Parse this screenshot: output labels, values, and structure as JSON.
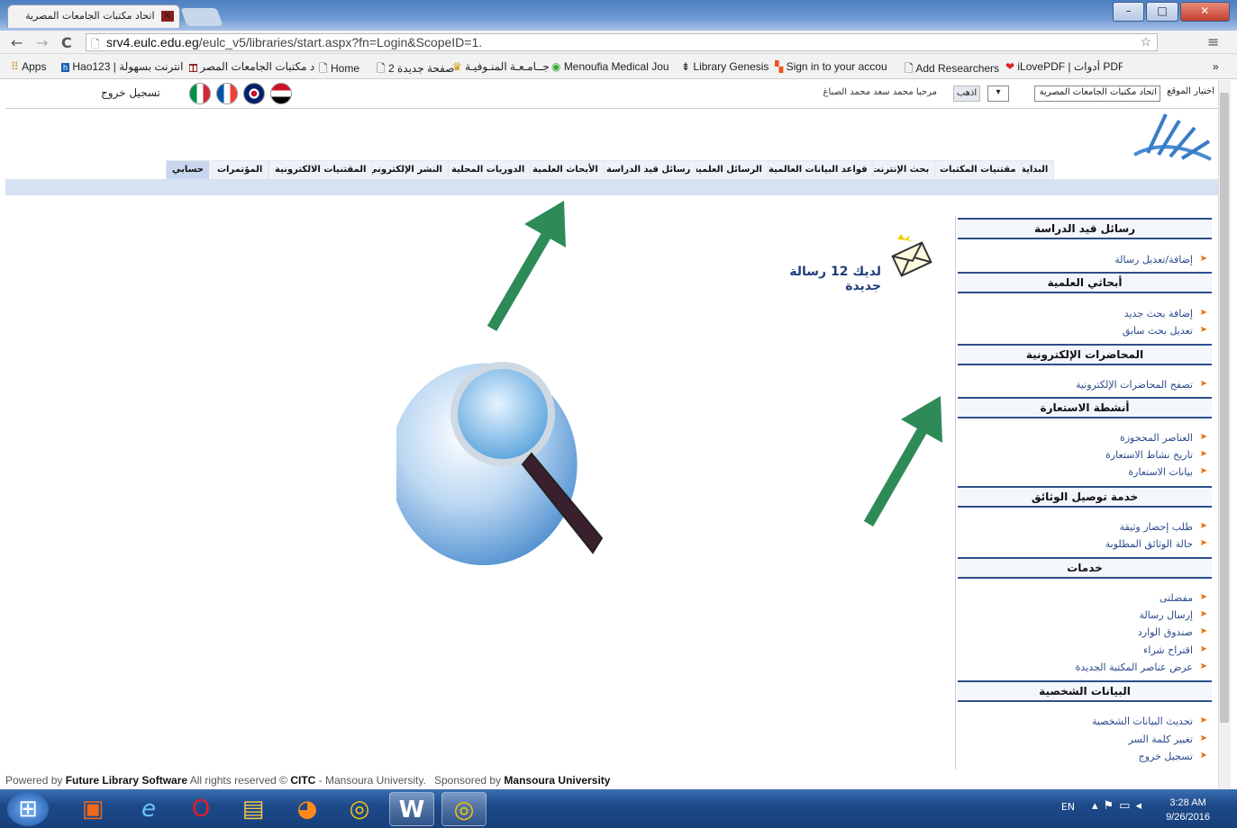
{
  "browser": {
    "tab_title": "اتحاد مكتبات الجامعات المصرية",
    "url_host": "srv4.eulc.edu.eg",
    "url_path": "/eulc_v5/libraries/start.aspx?fn=Login&ScopeID=1."
  },
  "bookmarks": [
    "Apps",
    "Hao123 | انترنت بسهولة",
    "اتحاد مكتبات الجامعات المصر",
    "Home",
    "صفحة جديدة 2",
    "جــامـعـة المنـوفيـة",
    "Menoufia Medical Jou",
    "Library Genesis",
    "Sign in to your accou",
    "Add Researchers",
    "iLovePDF | أدوات PDF"
  ],
  "topline": {
    "site_label": "اختيار الموقع",
    "site_value": "اتحاد مكتبات الجامعات المصرية",
    "go_label": "اذهب",
    "welcome": "مرحبا  محمد سعد محمد الصباغ",
    "logout": "تسجيل خروج"
  },
  "menu": [
    "البداية",
    "مقتنيات المكتبات",
    "بحث الإنترنت",
    "قواعد البيانات العالمية",
    "الرسائل العلمية",
    "رسائل قيد الدراسة",
    "الأبحاث العلمية",
    "الدوريات المحلية",
    "النشر الإلكتروني",
    "المقتنيات الالكترونية",
    "المؤتمرات",
    "حسابي"
  ],
  "notice": "لديك 12 رسالة جديدة",
  "sidebar": {
    "s1": {
      "title": "رسائل قيد الدراسة",
      "items": [
        "إضافة/تعديل رسالة"
      ]
    },
    "s2": {
      "title": "أبحاثي العلمية",
      "items": [
        "إضافة بحث جديد",
        "تعديل بحث سابق"
      ]
    },
    "s3": {
      "title": "المحاضرات الإلكترونية",
      "items": [
        "تصفح المحاضرات الإلكترونية"
      ]
    },
    "s4": {
      "title": "أنشطة الاستعارة",
      "items": [
        "العناصر المحجوزة",
        "تاريخ نشاط الاستعارة",
        "بيانات الاستعارة"
      ]
    },
    "s5": {
      "title": "خدمة توصيل الوثائق",
      "items": [
        "طلب إحضار وثيقة",
        "حالة الوثائق المطلوبة"
      ]
    },
    "s6": {
      "title": "خدمات",
      "items": [
        "مفضلتى",
        "إرسال رسالة",
        "صندوق الوارد",
        "اقتراح شراء",
        "عرض عناصر المكتبة الجديدة"
      ]
    },
    "s7": {
      "title": "البيانات الشخصية",
      "items": [
        "تحديث البيانات الشخصية",
        "تغيير كلمة السر",
        "تسجيل خروج"
      ]
    }
  },
  "footer": {
    "powered_prefix": "Powered by",
    "powered_name": "Future Library Software",
    "rights": "All rights reserved ©",
    "citc": "CITC",
    "mansoura": "- Mansoura University.",
    "sponsored_prefix": "Sponsored by",
    "sponsored_name": "Mansoura University"
  },
  "taskbar": {
    "lang": "EN",
    "time": "3:28 AM",
    "date": "9/26/2016"
  },
  "colors": {
    "accent_arrow": "#2e8b57",
    "menu_active": "#c9d7ee",
    "section_border": "#2d4f8a",
    "link": "#2b4a8c"
  }
}
